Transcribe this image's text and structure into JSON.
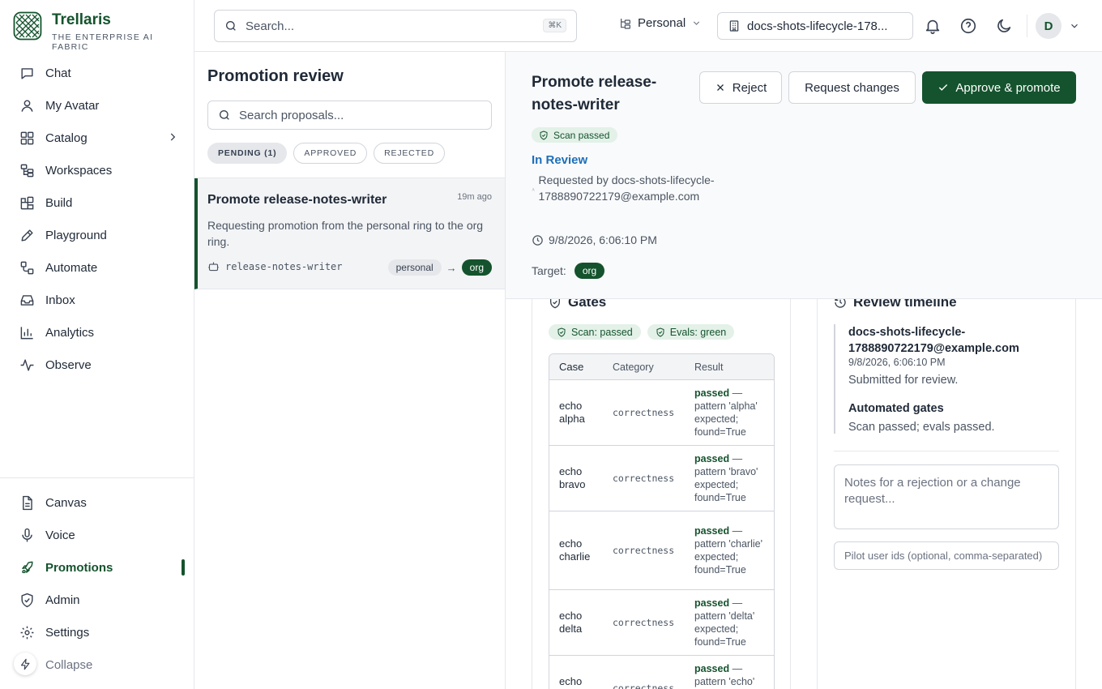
{
  "brand": {
    "name": "Trellaris",
    "tagline": "THE ENTERPRISE AI FABRIC"
  },
  "sidebar": {
    "primary": [
      {
        "label": "Chat",
        "icon": "chat-icon"
      },
      {
        "label": "My Avatar",
        "icon": "user-icon"
      },
      {
        "label": "Catalog",
        "icon": "grid-icon"
      },
      {
        "label": "Workspaces",
        "icon": "workspaces-icon"
      },
      {
        "label": "Build",
        "icon": "build-icon"
      },
      {
        "label": "Playground",
        "icon": "pencil-icon"
      },
      {
        "label": "Automate",
        "icon": "automate-icon"
      },
      {
        "label": "Inbox",
        "icon": "inbox-icon"
      },
      {
        "label": "Analytics",
        "icon": "bar-chart-icon"
      },
      {
        "label": "Observe",
        "icon": "activity-icon"
      }
    ],
    "secondary": [
      {
        "label": "Canvas",
        "icon": "document-icon"
      },
      {
        "label": "Voice",
        "icon": "mic-icon"
      },
      {
        "label": "Promotions",
        "icon": "rocket-icon",
        "active": true
      },
      {
        "label": "Admin",
        "icon": "shield-icon"
      },
      {
        "label": "Settings",
        "icon": "gear-icon"
      },
      {
        "label": "Collapse",
        "icon": "collapse-icon"
      }
    ],
    "active_color": "#14532d"
  },
  "topbar": {
    "search_placeholder": "Search...",
    "shortcut": "⌘K",
    "workspace": "Personal",
    "project": "docs-shots-lifecycle-178...",
    "avatar_initial": "D"
  },
  "list": {
    "title": "Promotion review",
    "search_placeholder": "Search proposals...",
    "filters": [
      {
        "label": "PENDING (1)",
        "active": true
      },
      {
        "label": "APPROVED",
        "active": false
      },
      {
        "label": "REJECTED",
        "active": false
      }
    ],
    "items": [
      {
        "title": "Promote release-notes-writer",
        "time": "19m ago",
        "description": "Requesting promotion from the personal ring to the org ring.",
        "asset": "release-notes-writer",
        "from_ring": "personal",
        "arrow": "→",
        "to_ring": "org"
      }
    ]
  },
  "detail": {
    "title": "Promote release-notes-writer",
    "scan_badge": "Scan passed",
    "state": "In Review",
    "requested_by": "Requested by docs-shots-lifecycle-1788890722179@example.com",
    "timestamp": "9/8/2026, 6:06:10 PM",
    "target_label": "Target:",
    "target": "org",
    "actions": {
      "reject": "Reject",
      "request_changes": "Request changes",
      "approve": "Approve & promote"
    }
  },
  "gates": {
    "title": "Gates",
    "badges": [
      "Scan: passed",
      "Evals: green"
    ],
    "columns": [
      "Case",
      "Category",
      "Result"
    ],
    "rows": [
      {
        "case": "echo alpha",
        "category": "correctness",
        "status": "passed",
        "detail": " — pattern 'alpha' expected; found=True"
      },
      {
        "case": "echo bravo",
        "category": "correctness",
        "status": "passed",
        "detail": " — pattern 'bravo' expected; found=True"
      },
      {
        "case": "echo charlie",
        "category": "correctness",
        "status": "passed",
        "detail": " — pattern 'charlie' expected; found=True"
      },
      {
        "case": "echo delta",
        "category": "correctness",
        "status": "passed",
        "detail": " — pattern 'delta' expected; found=True"
      },
      {
        "case": "echo echo",
        "category": "correctness",
        "status": "passed",
        "detail": " — pattern 'echo' expected; found=True"
      }
    ]
  },
  "timeline": {
    "title": "Review timeline",
    "actor": "docs-shots-lifecycle-1788890722179@example.com",
    "date": "9/8/2026, 6:06:10 PM",
    "note": "Submitted for review.",
    "event2_title": "Automated gates",
    "event2_note": "Scan passed; evals passed.",
    "notes_placeholder": "Notes for a rejection or a change request...",
    "pilot_placeholder": "Pilot user ids (optional, comma-separated)"
  }
}
